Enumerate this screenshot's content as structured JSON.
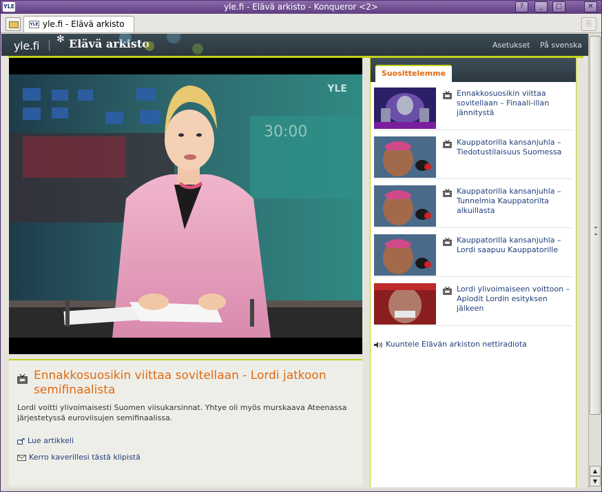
{
  "window": {
    "title": "yle.fi - Elävä arkisto - Konqueror <2>",
    "app_icon_text": "YLE",
    "buttons": [
      "?",
      "_",
      "□",
      "✕"
    ]
  },
  "tabs": [
    {
      "label": "yle.fi - Elävä arkisto",
      "favicon_text": "YLE"
    }
  ],
  "header": {
    "logo": "yle.fi",
    "brand": "Elävä arkisto",
    "nav": [
      "Asetukset",
      "På svenska"
    ]
  },
  "video": {
    "channel_bug": "YLE"
  },
  "article": {
    "headline": "Ennakkosuosikin viittaa sovitellaan - Lordi jatkoon semifinaalista",
    "description": "Lordi voitti ylivoimaisesti Suomen viisukarsinnat. Yhtye oli myös murskaava Ateenassa järjestetyssä euroviisujen semifinaalissa.",
    "read_link": "Lue artikkeli",
    "share_link": "Kerro kaverillesi tästä klipistä"
  },
  "recommendations": {
    "tab_label": "Suosittelemme",
    "items": [
      {
        "title": "Ennakkosuosikin viittaa sovitellaan – Finaali-illan jännitystä"
      },
      {
        "title": "Kauppatorilla kansanjuhla – Tiedotustilaisuus Suomessa"
      },
      {
        "title": "Kauppatorilla kansanjuhla – Tunnelmia Kauppatorilta alkuillasta"
      },
      {
        "title": "Kauppatorilla kansanjuhla – Lordi saapuu Kauppatorille"
      },
      {
        "title": "Lordi ylivoimaiseen voittoon – Aplodit Lordin esityksen jälkeen"
      }
    ],
    "radio_link": "Kuuntele Elävän arkiston nettiradiota"
  },
  "colors": {
    "accent_green": "#c4d21a",
    "headline_orange": "#e06a10",
    "link_blue": "#1f3f7a",
    "header_dark": "#2a363e"
  }
}
